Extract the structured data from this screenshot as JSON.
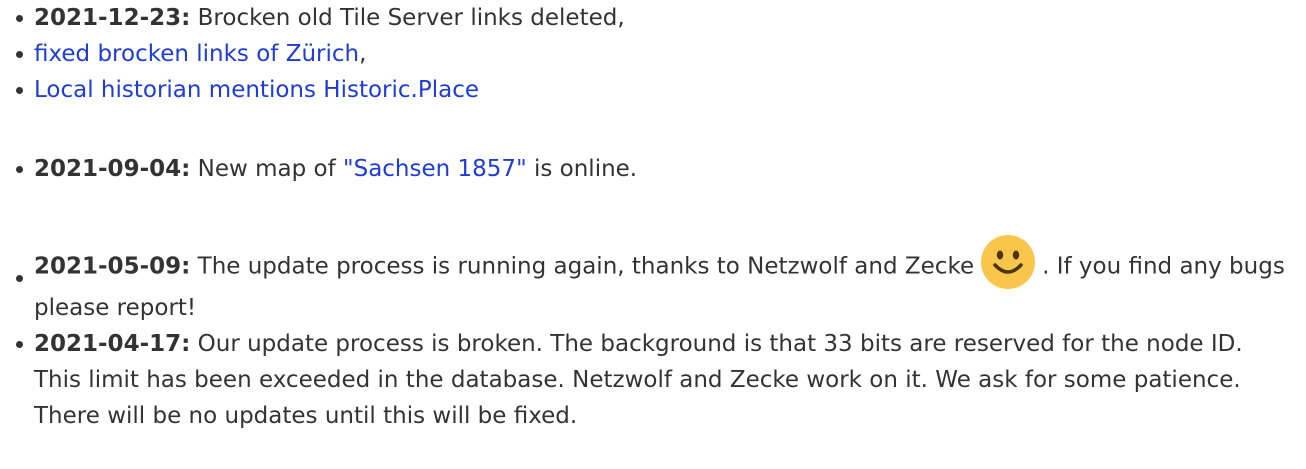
{
  "news": {
    "item0": {
      "date": "2021-12-23:",
      "text": " Brocken old Tile Server links deleted,"
    },
    "item1": {
      "link": "fixed brocken links of Zürich",
      "suffix": ","
    },
    "item2": {
      "link": "Local historian mentions Historic.Place"
    },
    "item3": {
      "date": "2021-09-04:",
      "text_before": " New map of ",
      "link": "\"Sachsen 1857\"",
      "text_after": " is online."
    },
    "item4": {
      "date": "2021-05-09:",
      "text_before": " The update process is running again, thanks to Netzwolf and Zecke",
      "text_after": ". If you find any bugs please report!",
      "emoji_icon": "smiley-face-icon"
    },
    "item5": {
      "date": "2021-04-17:",
      "text": " Our update process is broken. The background is that 33 bits are reserved for the node ID. This limit has been exceeded in the database. Netzwolf and Zecke work on it. We ask for some patience. There will be no updates until this will be fixed."
    }
  },
  "colors": {
    "text": "#333333",
    "link": "#1f3cd4",
    "emoji_face": "#f7c64a",
    "emoji_features": "#4b3414"
  }
}
